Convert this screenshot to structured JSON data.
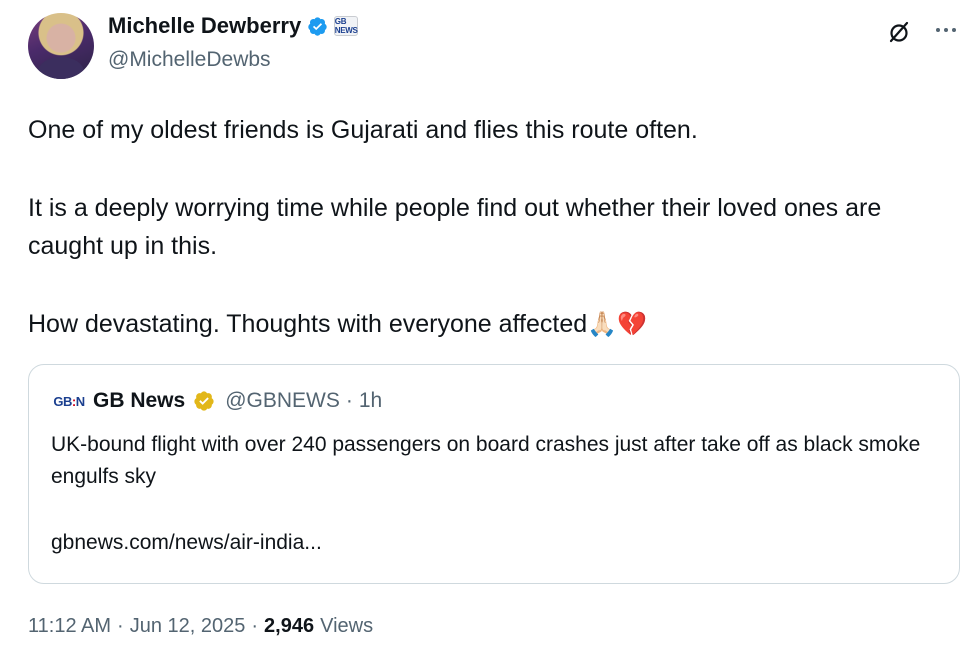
{
  "author": {
    "name": "Michelle Dewberry",
    "handle": "@MichelleDewbs",
    "affiliation_badge": "GB NEWS"
  },
  "tweet": {
    "paragraphs": [
      "One of my oldest friends is Gujarati  and flies this route often.",
      "It is a deeply worrying time while people find out whether their loved ones are caught up in this.",
      "How devastating. Thoughts with everyone affected"
    ],
    "emojis": "🙏🏻💔"
  },
  "quote": {
    "logo": "GB:NEWS",
    "name": "GB News",
    "handle": "@GBNEWS",
    "separator": "·",
    "time": "1h",
    "text": "UK-bound flight with over 240 passengers on board crashes just after take off as black smoke engulfs sky",
    "link": "gbnews.com/news/air-india..."
  },
  "meta": {
    "time": "11:12 AM",
    "sep1": "·",
    "date": "Jun 12, 2025",
    "sep2": "·",
    "views_count": "2,946",
    "views_label": "Views"
  },
  "icons": {
    "verified": "verified-badge-blue",
    "gold_verified": "verified-badge-gold",
    "grok": "grok-slash-icon",
    "more": "more-horizontal-icon"
  },
  "colors": {
    "text": "#0f1419",
    "secondary": "#536471",
    "verified_blue": "#1d9bf0",
    "verified_gold": "#e2b719",
    "border": "#cfd9de"
  }
}
